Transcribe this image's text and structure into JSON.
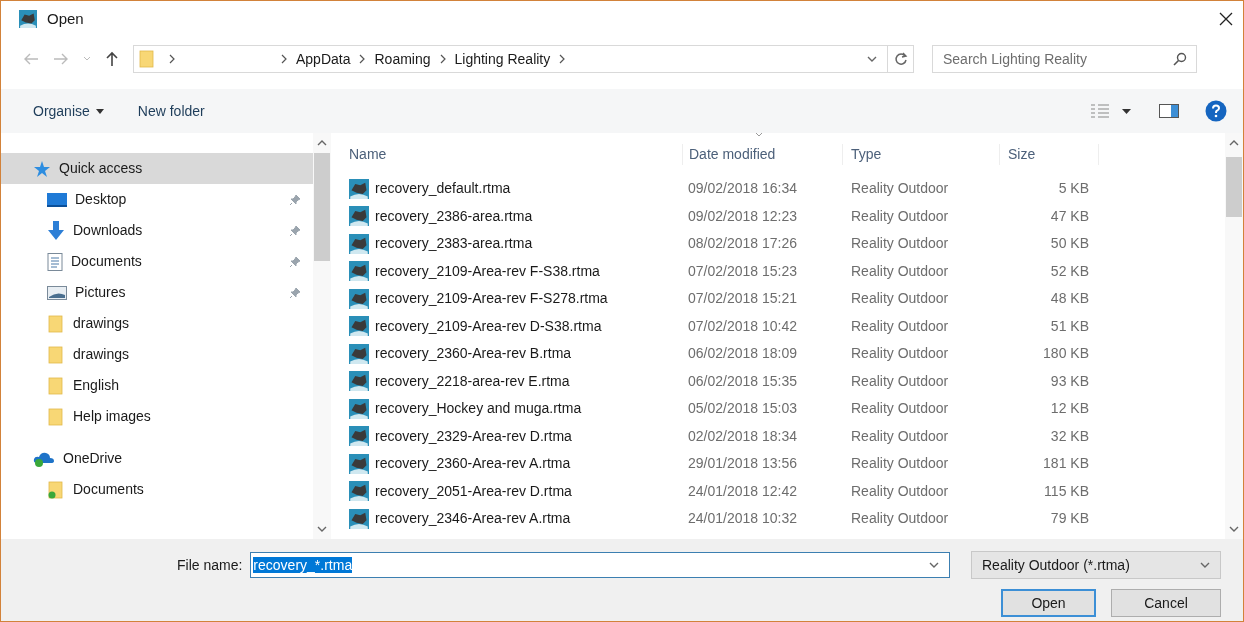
{
  "window": {
    "title": "Open"
  },
  "breadcrumb": [
    "AppData",
    "Roaming",
    "Lighting Reality"
  ],
  "search": {
    "placeholder": "Search Lighting Reality"
  },
  "toolbar": {
    "organise": "Organise",
    "new_folder": "New folder"
  },
  "sidebar": {
    "items": [
      {
        "label": "Quick access",
        "kind": "star",
        "selected": true,
        "pinned": false,
        "sub": false
      },
      {
        "label": "Desktop",
        "kind": "desktop",
        "selected": false,
        "pinned": true,
        "sub": true
      },
      {
        "label": "Downloads",
        "kind": "download",
        "selected": false,
        "pinned": true,
        "sub": true
      },
      {
        "label": "Documents",
        "kind": "document",
        "selected": false,
        "pinned": true,
        "sub": true
      },
      {
        "label": "Pictures",
        "kind": "pictures",
        "selected": false,
        "pinned": true,
        "sub": true
      },
      {
        "label": "drawings",
        "kind": "folder",
        "selected": false,
        "pinned": false,
        "sub": true
      },
      {
        "label": "drawings",
        "kind": "folder",
        "selected": false,
        "pinned": false,
        "sub": true
      },
      {
        "label": "English",
        "kind": "folder",
        "selected": false,
        "pinned": false,
        "sub": true
      },
      {
        "label": "Help images",
        "kind": "folder",
        "selected": false,
        "pinned": false,
        "sub": true
      },
      {
        "label": "OneDrive",
        "kind": "cloud",
        "selected": false,
        "pinned": false,
        "sub": false
      },
      {
        "label": "Documents",
        "kind": "synced-folder",
        "selected": false,
        "pinned": false,
        "sub": true
      }
    ]
  },
  "table": {
    "columns": [
      "Name",
      "Date modified",
      "Type",
      "Size"
    ],
    "rows": [
      {
        "name": "recovery_default.rtma",
        "date": "09/02/2018 16:34",
        "type": "Reality Outdoor",
        "size": "5 KB"
      },
      {
        "name": "recovery_2386-area.rtma",
        "date": "09/02/2018 12:23",
        "type": "Reality Outdoor",
        "size": "47 KB"
      },
      {
        "name": "recovery_2383-area.rtma",
        "date": "08/02/2018 17:26",
        "type": "Reality Outdoor",
        "size": "50 KB"
      },
      {
        "name": "recovery_2109-Area-rev F-S38.rtma",
        "date": "07/02/2018 15:23",
        "type": "Reality Outdoor",
        "size": "52 KB"
      },
      {
        "name": "recovery_2109-Area-rev F-S278.rtma",
        "date": "07/02/2018 15:21",
        "type": "Reality Outdoor",
        "size": "48 KB"
      },
      {
        "name": "recovery_2109-Area-rev D-S38.rtma",
        "date": "07/02/2018 10:42",
        "type": "Reality Outdoor",
        "size": "51 KB"
      },
      {
        "name": "recovery_2360-Area-rev B.rtma",
        "date": "06/02/2018 18:09",
        "type": "Reality Outdoor",
        "size": "180 KB"
      },
      {
        "name": "recovery_2218-area-rev E.rtma",
        "date": "06/02/2018 15:35",
        "type": "Reality Outdoor",
        "size": "93 KB"
      },
      {
        "name": "recovery_Hockey and muga.rtma",
        "date": "05/02/2018 15:03",
        "type": "Reality Outdoor",
        "size": "12 KB"
      },
      {
        "name": "recovery_2329-Area-rev D.rtma",
        "date": "02/02/2018 18:34",
        "type": "Reality Outdoor",
        "size": "32 KB"
      },
      {
        "name": "recovery_2360-Area-rev A.rtma",
        "date": "29/01/2018 13:56",
        "type": "Reality Outdoor",
        "size": "181 KB"
      },
      {
        "name": "recovery_2051-Area-rev D.rtma",
        "date": "24/01/2018 12:42",
        "type": "Reality Outdoor",
        "size": "115 KB"
      },
      {
        "name": "recovery_2346-Area-rev A.rtma",
        "date": "24/01/2018 10:32",
        "type": "Reality Outdoor",
        "size": "79 KB"
      }
    ]
  },
  "footer": {
    "file_name_label": "File name:",
    "file_name_value": "recovery_*.rtma",
    "file_type": "Reality Outdoor (*.rtma)",
    "open": "Open",
    "cancel": "Cancel"
  }
}
